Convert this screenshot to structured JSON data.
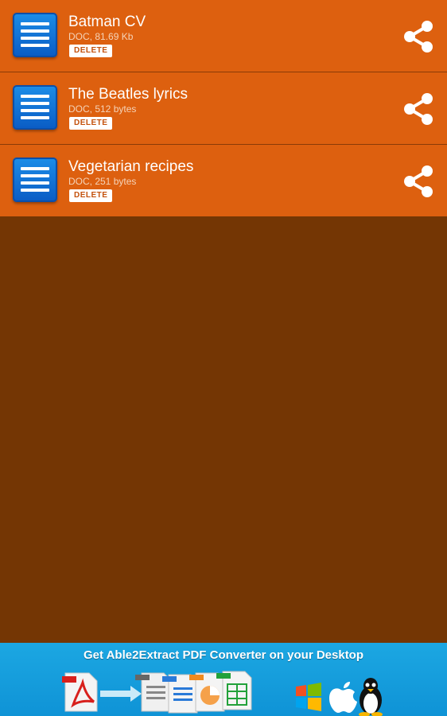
{
  "files": [
    {
      "name": "Batman CV",
      "meta": "DOC, 81.69 Kb",
      "delete_label": "DELETE"
    },
    {
      "name": "The Beatles lyrics",
      "meta": "DOC, 512 bytes",
      "delete_label": "DELETE"
    },
    {
      "name": "Vegetarian recipes",
      "meta": "DOC, 251 bytes",
      "delete_label": "DELETE"
    }
  ],
  "ad": {
    "text": "Get Able2Extract PDF Converter on your Desktop",
    "icons": [
      "pdf-icon",
      "arrow-icon",
      "document-icons",
      "windows-icon",
      "apple-icon",
      "linux-icon"
    ]
  },
  "colors": {
    "row_bg": "#dd600f",
    "background": "#743604",
    "doc_icon_blue": "#0a5bc4",
    "ad_bg": "#1ca7e2"
  }
}
